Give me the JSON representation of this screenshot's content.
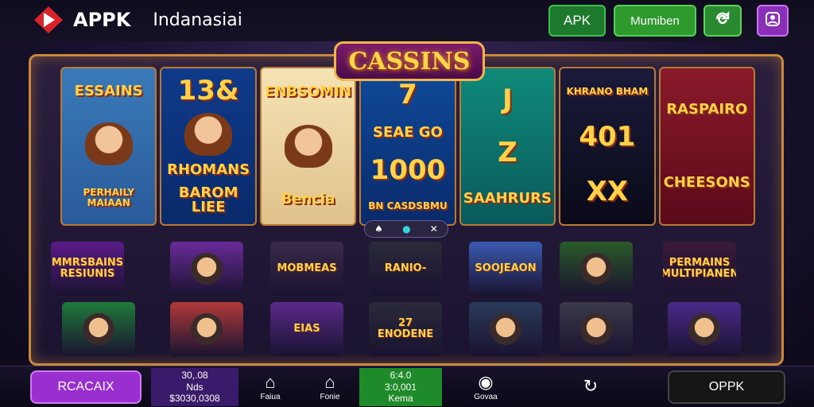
{
  "header": {
    "brand_name": "APPK",
    "brand_subtitle": "Indanasiai",
    "apk_button": "APK",
    "members_button": "Mumiben",
    "refresh_icon": "refresh-icon",
    "profile_icon": "user-profile-icon"
  },
  "marquee": {
    "title": "CASSINS",
    "reels": [
      {
        "symbols": [
          "ESSAINS",
          "PERHAILY MAIAAN"
        ],
        "colors": [
          "#3a7ab8",
          "#2a5a9a"
        ]
      },
      {
        "symbols": [
          "13&",
          "RHOMANS",
          "BAROM LIEE"
        ],
        "colors": [
          "#0f3a8a",
          "#0a2a6a"
        ]
      },
      {
        "symbols": [
          "ENBSOMIN",
          "Bencia"
        ],
        "colors": [
          "#f5e3b5",
          "#e0c28a"
        ]
      },
      {
        "symbols": [
          "7",
          "SEAE GO",
          "1000",
          "BN CASDSBMU"
        ],
        "colors": [
          "#0f4a9a",
          "#0a2a6a"
        ]
      },
      {
        "symbols": [
          "J",
          "Z",
          "SAAHRURS"
        ],
        "colors": [
          "#0f8a7a",
          "#0a5a5a"
        ]
      },
      {
        "symbols": [
          "KHRANO BHAM",
          "401",
          "XX"
        ],
        "colors": [
          "#1a1a3a",
          "#0a0a1a"
        ]
      },
      {
        "symbols": [
          "RASPAIRO",
          "CHEESONS"
        ],
        "colors": [
          "#8a1a2a",
          "#5a0a1a"
        ]
      }
    ],
    "pager": [
      "spade",
      "dot",
      "x"
    ]
  },
  "tiles": [
    {
      "label": "MMRSBAINS RESIUNIS",
      "bg": "#5a1a8a"
    },
    {
      "label": "",
      "bg": "#6a2a9a"
    },
    {
      "label": "MOBMEAS",
      "bg": "#3a2a4a"
    },
    {
      "label": "RANIO-",
      "bg": "#2a2a3a"
    },
    {
      "label": "SOOJEAON",
      "bg": "#3a5ab0"
    },
    {
      "label": "",
      "bg": "#2a5a2a"
    },
    {
      "label": "PERMAINS MULTIPIANEN",
      "bg": "#3a1a3a"
    },
    {
      "label": "",
      "bg": "#1f7a3a"
    },
    {
      "label": "",
      "bg": "#b03a3a"
    },
    {
      "label": "EIAS",
      "bg": "#5a2a8a"
    },
    {
      "label": "27 ENODENE",
      "bg": "#2a2a3a"
    },
    {
      "label": "",
      "bg": "#2a3a5a"
    },
    {
      "label": "",
      "bg": "#3a3a4a"
    },
    {
      "label": "",
      "bg": "#4a2a8a"
    }
  ],
  "bottom": {
    "cash_button": "RCACAIX",
    "balance": [
      "30,.08",
      "Nds",
      "$3030,0308"
    ],
    "nav": [
      {
        "icon": "home-icon",
        "glyph": "⌂",
        "label": "Faiua"
      },
      {
        "icon": "house-icon",
        "glyph": "⌂",
        "label": "Fonie"
      },
      {
        "icon": "chat-icon",
        "glyph": "◉",
        "label": "Govaa"
      },
      {
        "icon": "settings-icon",
        "glyph": "↻",
        "label": ""
      }
    ],
    "winnings": [
      "6:4.0",
      "3:0,001",
      "Kema"
    ],
    "oppk_button": "OPPK"
  },
  "colors": {
    "accent_gold": "#ffd24a",
    "frame": "#c88a3a",
    "green": "#2e9a2e",
    "purple": "#9a2fd0"
  }
}
